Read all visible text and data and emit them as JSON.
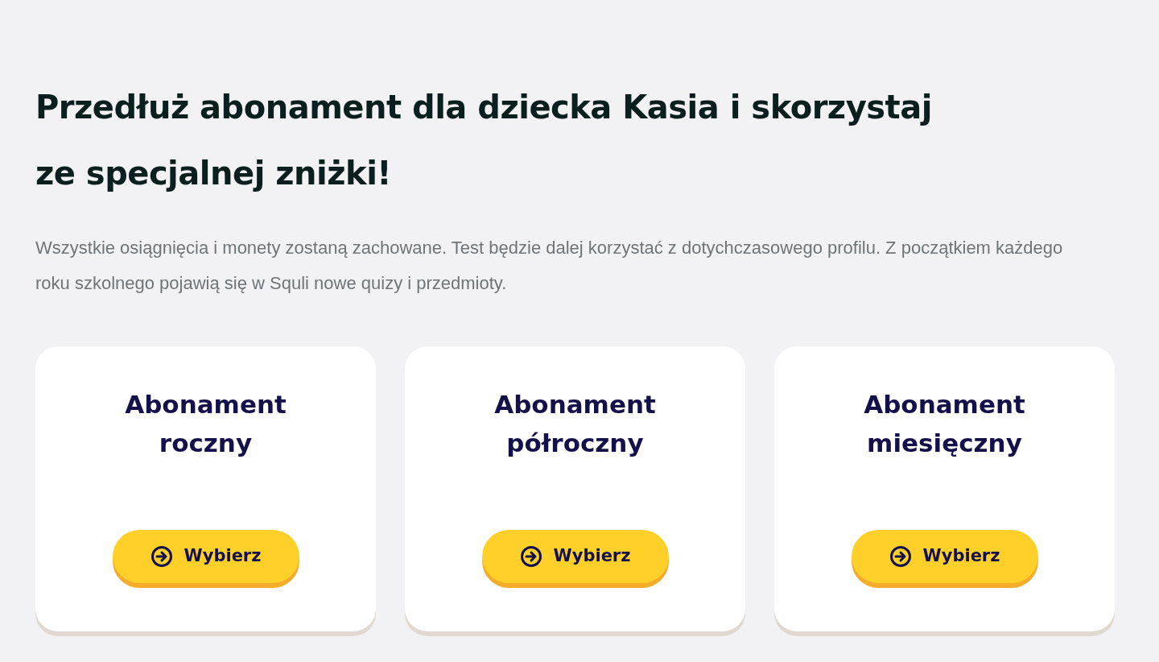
{
  "heading": "Przedłuż abonament dla dziecka Kasia i skorzystaj ze specjalnej zniżki!",
  "description": "Wszystkie osiągnięcia i monety zostaną zachowane. Test będzie dalej korzystać z dotychczasowego profilu. Z początkiem każdego roku szkolnego pojawią się w Squli nowe quizy i przedmioty.",
  "plans": [
    {
      "title": "Abonament roczny",
      "button": "Wybierz"
    },
    {
      "title": "Abonament półroczny",
      "button": "Wybierz"
    },
    {
      "title": "Abonament miesięczny",
      "button": "Wybierz"
    }
  ]
}
